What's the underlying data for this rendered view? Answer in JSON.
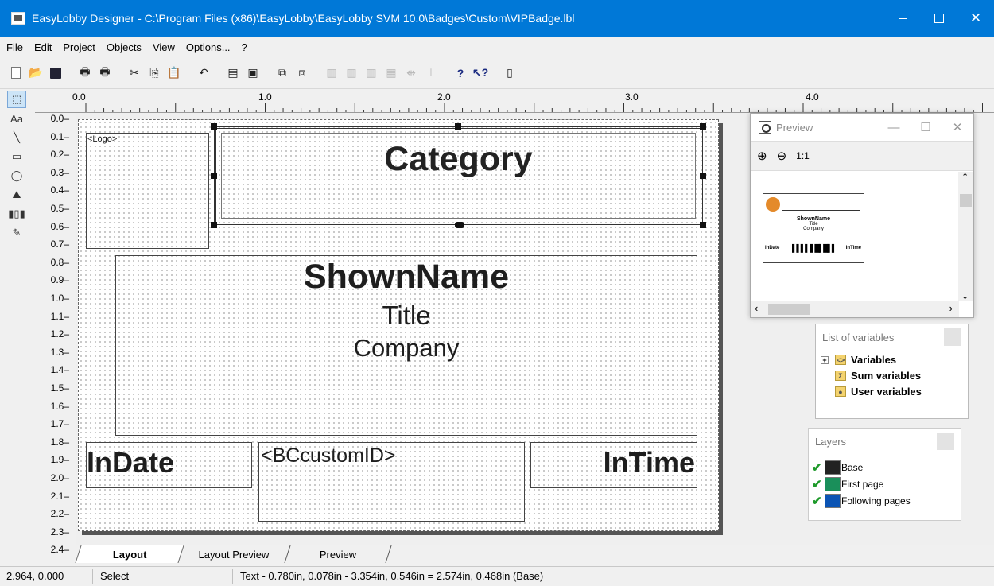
{
  "window": {
    "title": "EasyLobby Designer - C:\\Program Files (x86)\\EasyLobby\\EasyLobby SVM 10.0\\Badges\\Custom\\VIPBadge.lbl"
  },
  "menu": [
    "File",
    "Edit",
    "Project",
    "Objects",
    "View",
    "Options...",
    "?"
  ],
  "toolbar": {
    "icons": [
      "new-icon",
      "open-icon",
      "save-icon",
      "print-icon",
      "print-preview-icon",
      "cut-icon",
      "copy-icon",
      "paste-icon",
      "undo-icon",
      "properties-icon",
      "page-setup-icon",
      "bring-front-icon",
      "send-back-icon",
      "align-left-icon",
      "align-center-icon",
      "align-right-icon",
      "distribute-icon",
      "space-icon",
      "size-icon",
      "help-icon",
      "context-help-icon",
      "exit-icon"
    ],
    "help_glyph": "?",
    "context_help_glyph": "↖?"
  },
  "palette": {
    "text_tool": "Aa",
    "tools": [
      "select-tool-icon",
      "text-tool-icon",
      "line-tool-icon",
      "rectangle-tool-icon",
      "ellipse-tool-icon",
      "image-tool-icon",
      "barcode-tool-icon",
      "formatted-text-tool-icon"
    ]
  },
  "ruler": {
    "horizontal": [
      "0.0",
      "1.0",
      "2.0",
      "3.0",
      "4.0"
    ],
    "vertical": [
      "0.0",
      "0.1",
      "0.2",
      "0.3",
      "0.4",
      "0.5",
      "0.6",
      "0.7",
      "0.8",
      "0.9",
      "1.0",
      "1.1",
      "1.2",
      "1.3",
      "1.4",
      "1.5",
      "1.6",
      "1.7",
      "1.8",
      "1.9",
      "2.0",
      "2.1",
      "2.2",
      "2.3",
      "2.4"
    ]
  },
  "badge": {
    "logo": "<Logo>",
    "category": "Category",
    "shown_name": "ShownName",
    "title": "Title",
    "company": "Company",
    "in_date": "InDate",
    "barcode": "<BCcustomID>",
    "in_time": "InTime"
  },
  "tabs": {
    "layout": "Layout",
    "layout_preview": "Layout Preview",
    "preview": "Preview"
  },
  "status": {
    "coords": "2.964, 0.000",
    "mode": "Select",
    "info": "Text  -  0.780in, 0.078in  -  3.354in, 0.546in  =  2.574in, 0.468in (Base)"
  },
  "preview_window": {
    "title": "Preview",
    "zoom_in": "⊕",
    "zoom_out": "⊖",
    "zoom_reset": "1:1",
    "mini": {
      "name": "ShownName",
      "title": "Title",
      "company": "Company",
      "in_date": "InDate",
      "in_time": "InTime"
    }
  },
  "variables_panel": {
    "title": "List of variables",
    "items": [
      "Variables",
      "Sum variables",
      "User variables"
    ]
  },
  "layers_panel": {
    "title": "Layers",
    "items": [
      {
        "name": "Base",
        "color": "#222222"
      },
      {
        "name": "First page",
        "color": "#1a8f5a"
      },
      {
        "name": "Following pages",
        "color": "#0b54b4"
      }
    ]
  }
}
